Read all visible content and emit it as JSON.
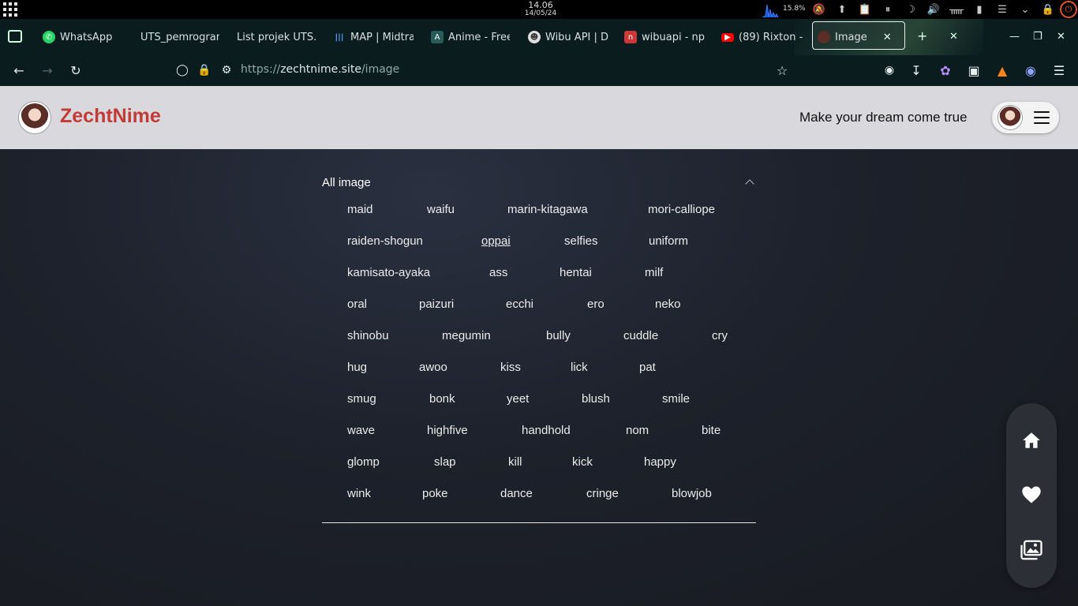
{
  "os": {
    "time": "14.06",
    "date": "14/05/24",
    "cpu_label": "15.8%"
  },
  "tabs": [
    {
      "label": "WhatsApp",
      "favicon": "whatsapp-icon"
    },
    {
      "label": "UTS_pemrogram",
      "favicon": "none"
    },
    {
      "label": "List projek UTS.p",
      "favicon": "none"
    },
    {
      "label": "MAP | Midtra",
      "favicon": "map-icon"
    },
    {
      "label": "Anime - Free",
      "favicon": "anime-icon"
    },
    {
      "label": "Wibu API | D",
      "favicon": "wibu-icon"
    },
    {
      "label": "wibuapi - np",
      "favicon": "npm-icon"
    },
    {
      "label": "(89) Rixton -",
      "favicon": "youtube-icon"
    },
    {
      "label": "Image",
      "favicon": "zechtnime-icon",
      "active": true
    }
  ],
  "urlbar": {
    "scheme": "https://",
    "host": "zechtnime.site",
    "path": "/image"
  },
  "header": {
    "logo_text": "ZechtNime",
    "tagline": "Make your dream come true"
  },
  "accordion": {
    "title": "All image",
    "rows": [
      [
        "maid",
        "waifu",
        "marin-kitagawa",
        "mori-calliope"
      ],
      [
        "raiden-shogun",
        "oppai",
        "selfies",
        "uniform"
      ],
      [
        "kamisato-ayaka",
        "ass",
        "hentai",
        "milf"
      ],
      [
        "oral",
        "paizuri",
        "ecchi",
        "ero",
        "neko"
      ],
      [
        "shinobu",
        "megumin",
        "bully",
        "cuddle",
        "cry"
      ],
      [
        "hug",
        "awoo",
        "kiss",
        "lick",
        "pat"
      ],
      [
        "smug",
        "bonk",
        "yeet",
        "blush",
        "smile"
      ],
      [
        "wave",
        "highfive",
        "handhold",
        "nom",
        "bite"
      ],
      [
        "glomp",
        "slap",
        "kill",
        "kick",
        "happy"
      ],
      [
        "wink",
        "poke",
        "dance",
        "cringe",
        "blowjob"
      ]
    ],
    "active_item": "oppai"
  },
  "side_nav": [
    "home-icon",
    "heart-icon",
    "gallery-icon"
  ],
  "colors": {
    "accent": "#c23b36",
    "header_bg": "#d9d8dc",
    "browser_bg": "#0b1c1e"
  }
}
